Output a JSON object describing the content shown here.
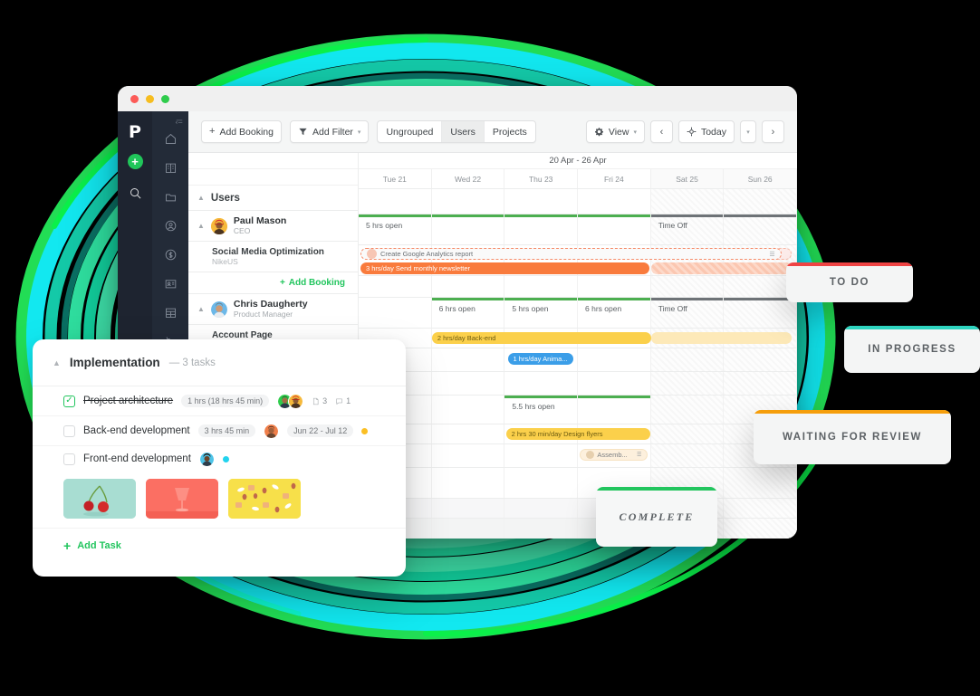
{
  "window": {
    "lights": [
      "close",
      "minimize",
      "maximize"
    ]
  },
  "rails": {
    "brand_logo": "P",
    "add_fab_label": "+",
    "collapse_icon": "collapse-icon",
    "search_icon": "search-icon",
    "nav_icons": [
      "home-icon",
      "building-icon",
      "folder-icon",
      "user-circle-icon",
      "dollar-circle-icon",
      "id-card-icon",
      "table-grid-icon",
      "refresh-icon",
      "wallet-search-icon",
      "pie-chart-icon"
    ]
  },
  "toolbar": {
    "add_booking": "Add Booking",
    "add_filter": "Add Filter",
    "segments": [
      {
        "label": "Ungrouped",
        "active": false
      },
      {
        "label": "Users",
        "active": true
      },
      {
        "label": "Projects",
        "active": false
      }
    ],
    "view_label": "View",
    "today_label": "Today",
    "prev_label": "‹",
    "next_label": "›",
    "dropdown_caret": "▾"
  },
  "schedule": {
    "date_range": "20 Apr - 26 Apr",
    "days": [
      {
        "label": "Tue 21",
        "weekend": false
      },
      {
        "label": "Wed 22",
        "weekend": false
      },
      {
        "label": "Thu 23",
        "weekend": false
      },
      {
        "label": "Fri 24",
        "weekend": false
      },
      {
        "label": "Sat 25",
        "weekend": true
      },
      {
        "label": "Sun 26",
        "weekend": true
      }
    ],
    "group_label": "Users",
    "add_booking_label": "Add Booking",
    "users": [
      {
        "name": "Paul Mason",
        "role": "CEO",
        "avatar_color": "#f6b93b",
        "availability": [
          "5 hrs open",
          "",
          "",
          "",
          "Time Off",
          ""
        ],
        "availability_colors": [
          "#4caf50",
          "",
          "",
          "",
          "#6e7377",
          ""
        ],
        "project": {
          "name": "Social Media Optimization",
          "client": "NikeUS"
        },
        "bookings": [
          {
            "label": "Create Google Analytics report",
            "style": "dash",
            "start": 0,
            "span": 4,
            "ghost_span": 2,
            "row": 0,
            "has_note_icon": true
          },
          {
            "label": "3 hrs/day Send monthly newsletter",
            "style": "orange",
            "start": 0,
            "span": 4,
            "ghost_span": 2,
            "row": 1
          }
        ]
      },
      {
        "name": "Chris Daugherty",
        "role": "Product Manager",
        "avatar_color": "#58a7e0",
        "availability": [
          "",
          "6 hrs open",
          "5 hrs open",
          "6 hrs open",
          "Time Off",
          ""
        ],
        "availability_colors": [
          "",
          "#4caf50",
          "#4caf50",
          "#4caf50",
          "#6e7377",
          ""
        ],
        "project": {
          "name": "Account Page",
          "client": ""
        },
        "bookings": [
          {
            "label": "2 hrs/day Back-end",
            "style": "yellow",
            "start": 1,
            "span": 3,
            "ghost_span": 2,
            "row": 0
          },
          {
            "label": "1 hrs/day Anima...",
            "style": "blue",
            "start": 2,
            "span": 1,
            "ghost_span": 0,
            "row": 1
          }
        ]
      },
      {
        "name": "",
        "role": "",
        "avatar_color": "#bdbdbd",
        "availability": [
          "",
          "",
          "5.5 hrs open",
          "",
          "",
          ""
        ],
        "availability_colors": [
          "",
          "",
          "#4caf50",
          "",
          "",
          ""
        ],
        "project": {
          "name": "",
          "client": ""
        },
        "bookings": [
          {
            "label": "2 hrs 30 min/day Design flyers",
            "style": "yellow",
            "start": 2,
            "span": 2,
            "ghost_span": 0,
            "row": 0
          },
          {
            "label": "Assemb...",
            "style": "pale",
            "start": 3,
            "span": 1,
            "ghost_span": 0,
            "row": 1,
            "has_note_icon": true
          }
        ]
      }
    ]
  },
  "task_panel": {
    "collapse_icon": "chevron-up-icon",
    "title": "Implementation",
    "count_label": "— 3 tasks",
    "tasks": [
      {
        "name": "Project architecture",
        "done": true,
        "duration": "1 hrs (18 hrs 45 min)",
        "date_range": "",
        "avatars": [
          "#2fcc4c",
          "#f6b93b"
        ],
        "attachment_count": "3",
        "comment_count": "1",
        "status_dot": ""
      },
      {
        "name": "Back-end development",
        "done": false,
        "duration": "3 hrs 45 min",
        "date_range": "Jun 22 - Jul 12",
        "avatars": [
          "#f07f4a"
        ],
        "attachment_count": "",
        "comment_count": "",
        "status_dot": "#fbbf24"
      },
      {
        "name": "Front-end development",
        "done": false,
        "duration": "",
        "date_range": "",
        "avatars": [
          "#4ec4e8"
        ],
        "attachment_count": "",
        "comment_count": "",
        "status_dot": "#22d3ee"
      }
    ],
    "thumbnails": [
      {
        "name": "cherries-photo",
        "bg": "#a8ddd2"
      },
      {
        "name": "wine-glass-photo",
        "bg": "#fb6f63"
      },
      {
        "name": "snacks-photo",
        "bg": "#f7e04a"
      }
    ],
    "add_task_label": "Add Task",
    "add_task_icon": "plus-icon"
  },
  "status_cards": [
    {
      "id": "todo",
      "label": "TO DO",
      "accent": "#ef4444"
    },
    {
      "id": "prog",
      "label": "IN PROGRESS",
      "accent": "#2dd4bf"
    },
    {
      "id": "review",
      "label": "WAITING FOR REVIEW",
      "accent": "#f59e0b"
    },
    {
      "id": "comp",
      "label": "COMPLETE",
      "accent": "#22c55e"
    }
  ],
  "background": {
    "ring_colors": [
      "#22dd55",
      "#12e8f0",
      "#19e0b9",
      "#2fe0a0",
      "#3ddfa5",
      "#0fb39a",
      "#0c8f7d"
    ]
  }
}
